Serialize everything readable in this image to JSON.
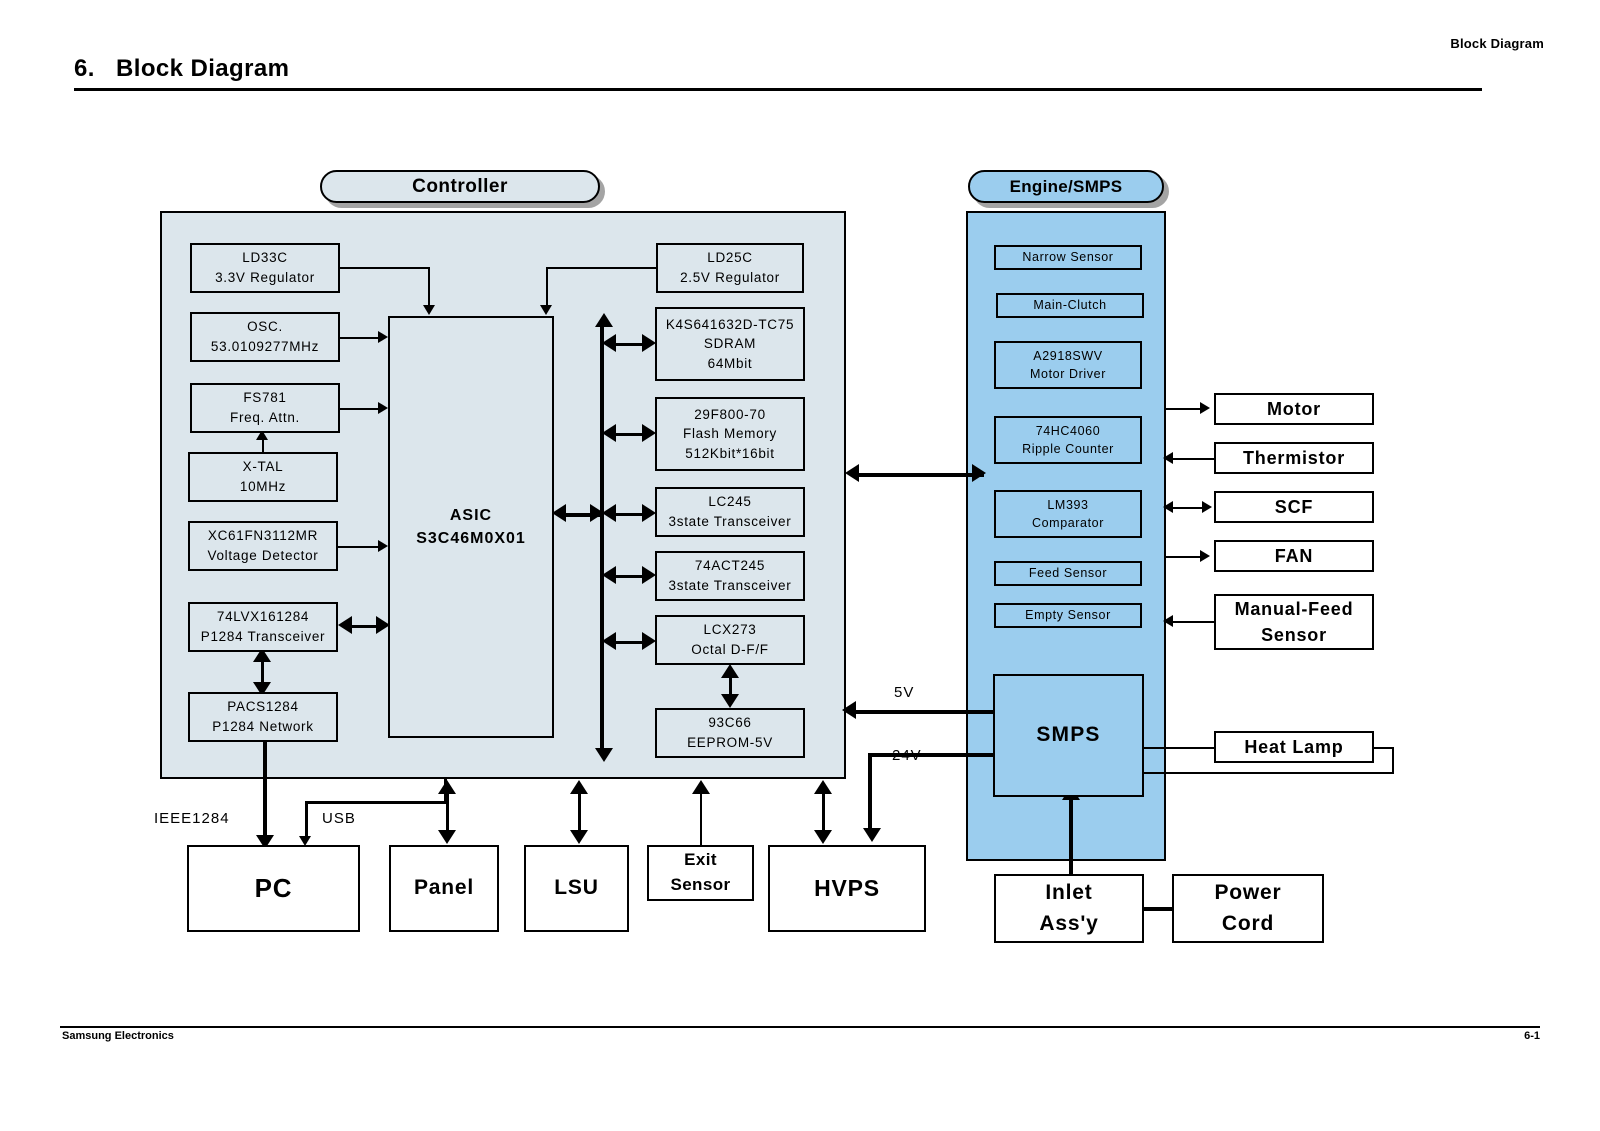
{
  "header": {
    "running_head": "Block Diagram",
    "section_number": "6.",
    "section_title": "Block Diagram"
  },
  "footer": {
    "company": "Samsung Electronics",
    "page": "6-1"
  },
  "sections": {
    "controller": {
      "tab_label": "Controller"
    },
    "engine": {
      "tab_label": "Engine/SMPS"
    }
  },
  "controller": {
    "asic": {
      "line1": "ASIC",
      "line2": "S3C46M0X01"
    },
    "left_chips": [
      {
        "line1": "LD33C",
        "line2": "3.3V  Regulator"
      },
      {
        "line1": "OSC.",
        "line2": "53.0109277MHz"
      },
      {
        "line1": "FS781",
        "line2": "Freq. Attn."
      },
      {
        "line1": "X-TAL",
        "line2": "10MHz"
      },
      {
        "line1": "XC61FN3112MR",
        "line2": "Voltage Detector"
      },
      {
        "line1": "74LVX161284",
        "line2": "P1284 Transceiver"
      },
      {
        "line1": "PACS1284",
        "line2": "P1284 Network"
      }
    ],
    "right_chips": [
      {
        "line1": "LD25C",
        "line2": "2.5V  Regulator"
      },
      {
        "line1": "K4S641632D-TC75",
        "line2": "SDRAM",
        "line3": "64Mbit"
      },
      {
        "line1": "29F800-70",
        "line2": "Flash Memory",
        "line3": "512Kbit*16bit"
      },
      {
        "line1": "LC245",
        "line2": "3state Transceiver"
      },
      {
        "line1": "74ACT245",
        "line2": "3state Transceiver"
      },
      {
        "line1": "LCX273",
        "line2": "Octal D-F/F"
      },
      {
        "line1": "93C66",
        "line2": "EEPROM-5V"
      }
    ]
  },
  "engine": {
    "chips": [
      {
        "line1": "Narrow Sensor"
      },
      {
        "line1": "Main-Clutch"
      },
      {
        "line1": "A2918SWV",
        "line2": "Motor Driver"
      },
      {
        "line1": "74HC4060",
        "line2": "Ripple Counter"
      },
      {
        "line1": "LM393",
        "line2": "Comparator"
      },
      {
        "line1": "Feed Sensor"
      },
      {
        "line1": "Empty Sensor"
      }
    ],
    "smps_label": "SMPS"
  },
  "peripherals_right": [
    {
      "label": "Motor"
    },
    {
      "label": "Thermistor"
    },
    {
      "label": "SCF"
    },
    {
      "label": "FAN"
    },
    {
      "line1": "Manual-Feed",
      "line2": "Sensor"
    },
    {
      "label": "Heat Lamp"
    }
  ],
  "peripherals_bottom": [
    {
      "label": "PC"
    },
    {
      "label": "Panel"
    },
    {
      "label": "LSU"
    },
    {
      "line1": "Exit",
      "line2": "Sensor"
    },
    {
      "label": "HVPS"
    },
    {
      "line1": "Inlet",
      "line2": "Ass'y"
    },
    {
      "line1": "Power",
      "line2": "Cord"
    }
  ],
  "bus_labels": {
    "ieee1284": "IEEE1284",
    "usb": "USB",
    "v5": "5V",
    "v24": "24V"
  },
  "colors": {
    "controller_fill": "#dce6ec",
    "engine_fill": "#9bcdee",
    "outline": "#000000",
    "page_background": "#ffffff"
  }
}
